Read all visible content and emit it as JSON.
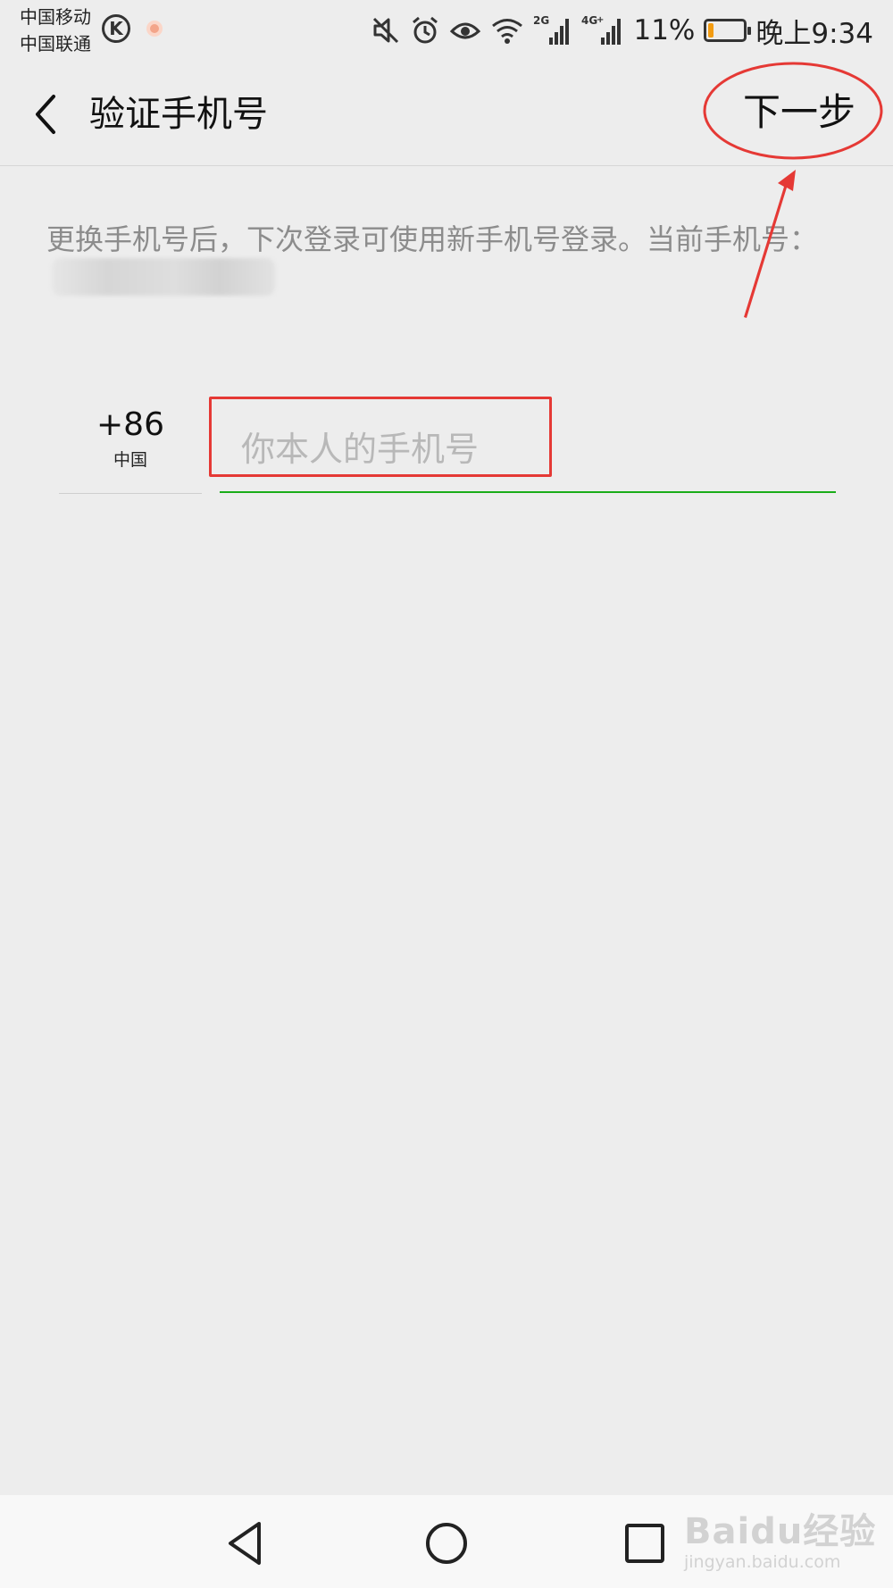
{
  "status_bar": {
    "carrier_1": "中国移动",
    "carrier_2": "中国联通",
    "app_icon": "K",
    "network_2g": "2G",
    "network_4g": "4G",
    "battery_percent": "11%",
    "battery_level": 0.11,
    "battery_color": "#f39c12",
    "time": "晚上9:34"
  },
  "toolbar": {
    "back_icon": "chevron-left-icon",
    "title": "验证手机号",
    "next_label": "下一步"
  },
  "info": {
    "text": "更换手机号后，下次登录可使用新手机号登录。当前手机号："
  },
  "phone": {
    "country_code": "+86",
    "country_name": "中国",
    "placeholder": "你本人的手机号",
    "accent_color": "#1aad19"
  },
  "annotation": {
    "color": "#e53935"
  },
  "watermark": {
    "main": "Baidu经验",
    "sub": "jingyan.baidu.com"
  }
}
